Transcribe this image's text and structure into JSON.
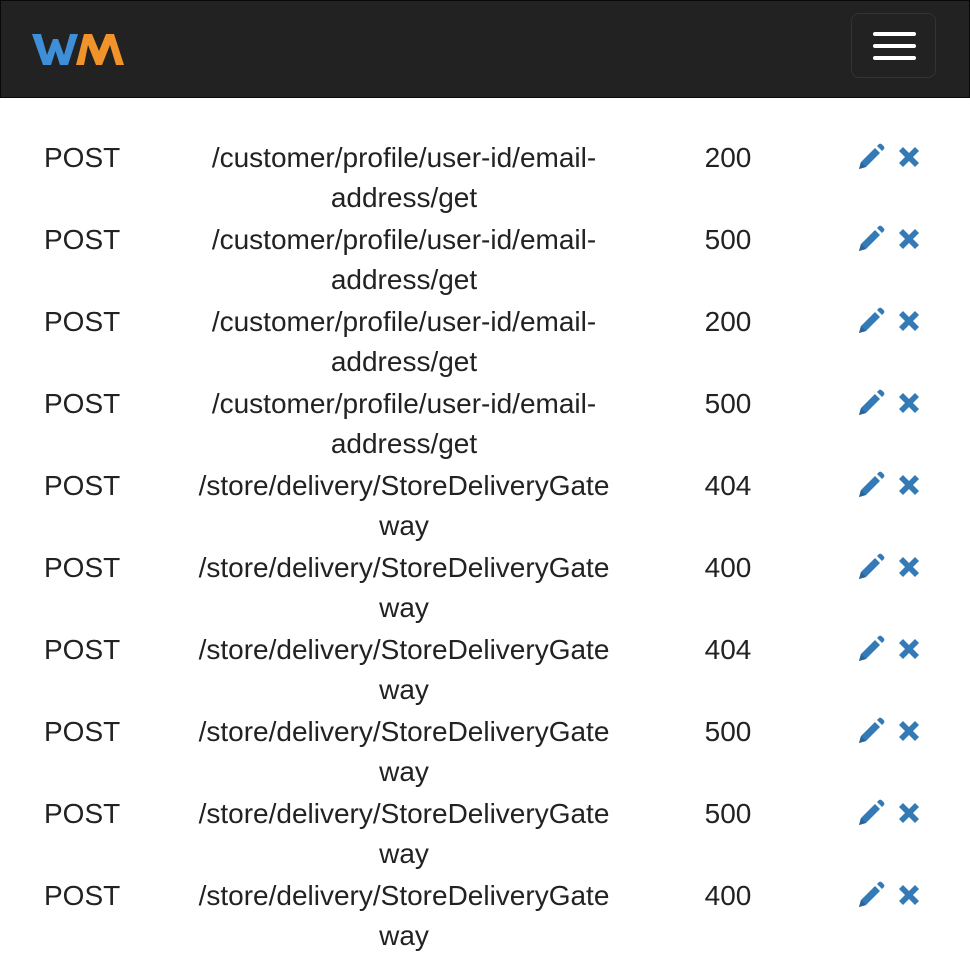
{
  "brand": {
    "logo_text": "WM",
    "colors": {
      "w": "#3e8fd8",
      "m": "#f0932b"
    }
  },
  "navbar": {
    "toggle_icon": "hamburger-menu-icon"
  },
  "accent": "#337ab7",
  "rows": [
    {
      "method": "POST",
      "endpoint_line1": "/customer/profile/user-id/email-",
      "endpoint_line2": "address/get",
      "status": "200"
    },
    {
      "method": "POST",
      "endpoint_line1": "/customer/profile/user-id/email-",
      "endpoint_line2": "address/get",
      "status": "500"
    },
    {
      "method": "POST",
      "endpoint_line1": "/customer/profile/user-id/email-",
      "endpoint_line2": "address/get",
      "status": "200"
    },
    {
      "method": "POST",
      "endpoint_line1": "/customer/profile/user-id/email-",
      "endpoint_line2": "address/get",
      "status": "500"
    },
    {
      "method": "POST",
      "endpoint_line1": "/store/delivery/StoreDeliveryGate",
      "endpoint_line2": "way",
      "status": "404"
    },
    {
      "method": "POST",
      "endpoint_line1": "/store/delivery/StoreDeliveryGate",
      "endpoint_line2": "way",
      "status": "400"
    },
    {
      "method": "POST",
      "endpoint_line1": "/store/delivery/StoreDeliveryGate",
      "endpoint_line2": "way",
      "status": "404"
    },
    {
      "method": "POST",
      "endpoint_line1": "/store/delivery/StoreDeliveryGate",
      "endpoint_line2": "way",
      "status": "500"
    },
    {
      "method": "POST",
      "endpoint_line1": "/store/delivery/StoreDeliveryGate",
      "endpoint_line2": "way",
      "status": "500"
    },
    {
      "method": "POST",
      "endpoint_line1": "/store/delivery/StoreDeliveryGate",
      "endpoint_line2": "way",
      "status": "400"
    }
  ],
  "row_icons": {
    "edit": "pencil-icon",
    "delete": "close-icon"
  }
}
